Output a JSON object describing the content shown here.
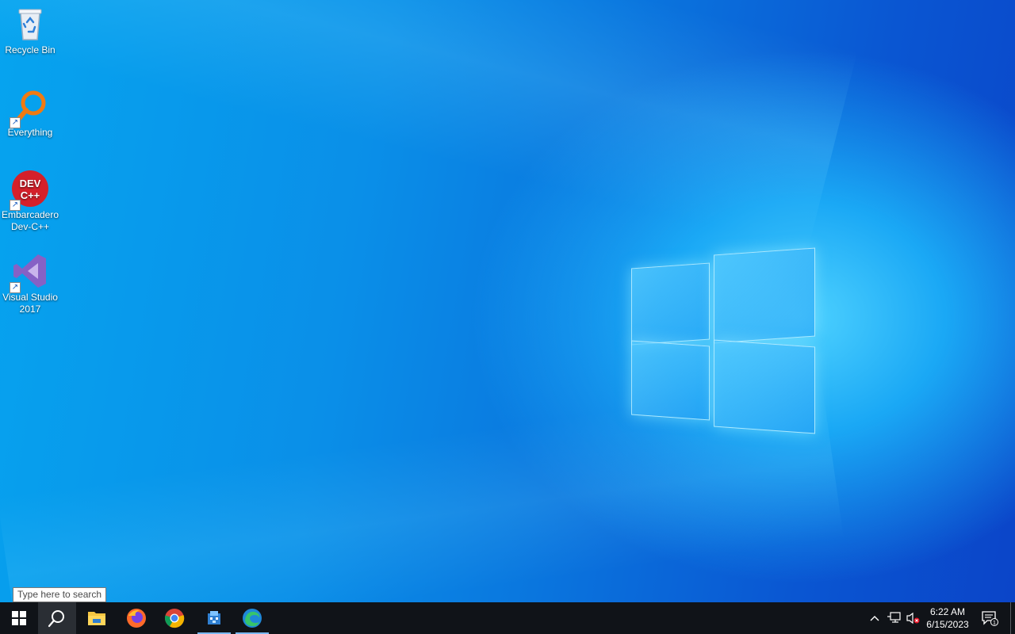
{
  "desktop": {
    "icons": [
      {
        "label": "Recycle Bin",
        "icon": "recycle-bin-icon"
      },
      {
        "label": "Everything",
        "icon": "everything-search-icon"
      },
      {
        "label": "Embarcadero\nDev-C++",
        "label_line1": "Embarcadero",
        "label_line2": "Dev-C++",
        "icon": "dev-cpp-icon",
        "icon_text1": "DEV",
        "icon_text2": "C++"
      },
      {
        "label_line1": "Visual Studio",
        "label_line2": "2017",
        "icon": "visual-studio-icon"
      }
    ]
  },
  "tooltip": {
    "text": "Type here to search"
  },
  "taskbar": {
    "buttons": [
      {
        "name": "start",
        "icon": "windows-start-icon"
      },
      {
        "name": "search",
        "icon": "search-icon"
      },
      {
        "name": "file-explorer",
        "icon": "folder-icon"
      },
      {
        "name": "firefox",
        "icon": "firefox-icon"
      },
      {
        "name": "chrome",
        "icon": "chrome-icon"
      },
      {
        "name": "app",
        "icon": "app-icon"
      },
      {
        "name": "edge",
        "icon": "edge-icon"
      }
    ],
    "clock": {
      "time": "6:22 AM",
      "date": "6/15/2023"
    },
    "notifications": {
      "count": "1"
    }
  },
  "colors": {
    "taskbar": "#101318",
    "accent": "#0a78df",
    "active_indicator": "#7ab8f0"
  }
}
